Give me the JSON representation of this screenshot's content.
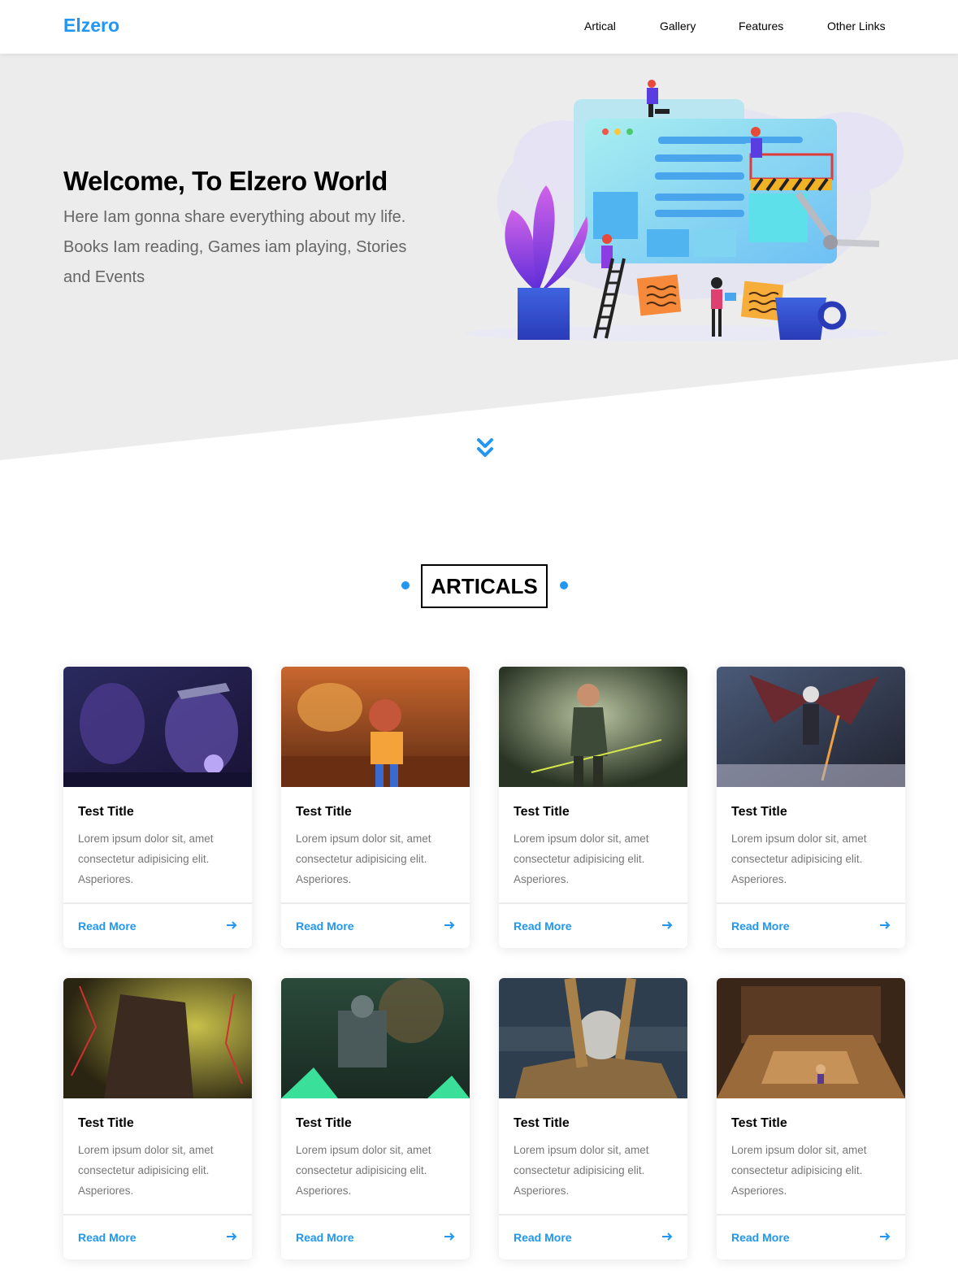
{
  "brand": {
    "logo": "Elzero",
    "accent_color": "#2196f3"
  },
  "nav": {
    "items": [
      {
        "label": "Artical"
      },
      {
        "label": "Gallery"
      },
      {
        "label": "Features"
      },
      {
        "label": "Other Links"
      }
    ]
  },
  "hero": {
    "title": "Welcome, To Elzero World",
    "text": "Here Iam gonna share everything about my life. Books Iam reading, Games iam playing, Stories and Events",
    "illustration_icon": "web-design-team-illustration",
    "scroll_icon": "double-chevron-down-icon"
  },
  "articles_section": {
    "title": "ARTICALS",
    "cards": [
      {
        "title": "Test Title",
        "text": "Lorem ipsum dolor sit, amet consectetur adipisicing elit. Asperiores.",
        "link": "Read More",
        "image": "fantasy-knight-purple"
      },
      {
        "title": "Test Title",
        "text": "Lorem ipsum dolor sit, amet consectetur adipisicing elit. Asperiores.",
        "link": "Read More",
        "image": "cartoon-character-autumn"
      },
      {
        "title": "Test Title",
        "text": "Lorem ipsum dolor sit, amet consectetur adipisicing elit. Asperiores.",
        "link": "Read More",
        "image": "archer-woman-forest"
      },
      {
        "title": "Test Title",
        "text": "Lorem ipsum dolor sit, amet consectetur adipisicing elit. Asperiores.",
        "link": "Read More",
        "image": "winged-angel-warrior"
      },
      {
        "title": "Test Title",
        "text": "Lorem ipsum dolor sit, amet consectetur adipisicing elit. Asperiores.",
        "link": "Read More",
        "image": "dark-armored-knight"
      },
      {
        "title": "Test Title",
        "text": "Lorem ipsum dolor sit, amet consectetur adipisicing elit. Asperiores.",
        "link": "Read More",
        "image": "green-robot-battle"
      },
      {
        "title": "Test Title",
        "text": "Lorem ipsum dolor sit, amet consectetur adipisicing elit. Asperiores.",
        "link": "Read More",
        "image": "stone-sphere-sculpture"
      },
      {
        "title": "Test Title",
        "text": "Lorem ipsum dolor sit, amet consectetur adipisicing elit. Asperiores.",
        "link": "Read More",
        "image": "wooden-room-character"
      }
    ]
  }
}
